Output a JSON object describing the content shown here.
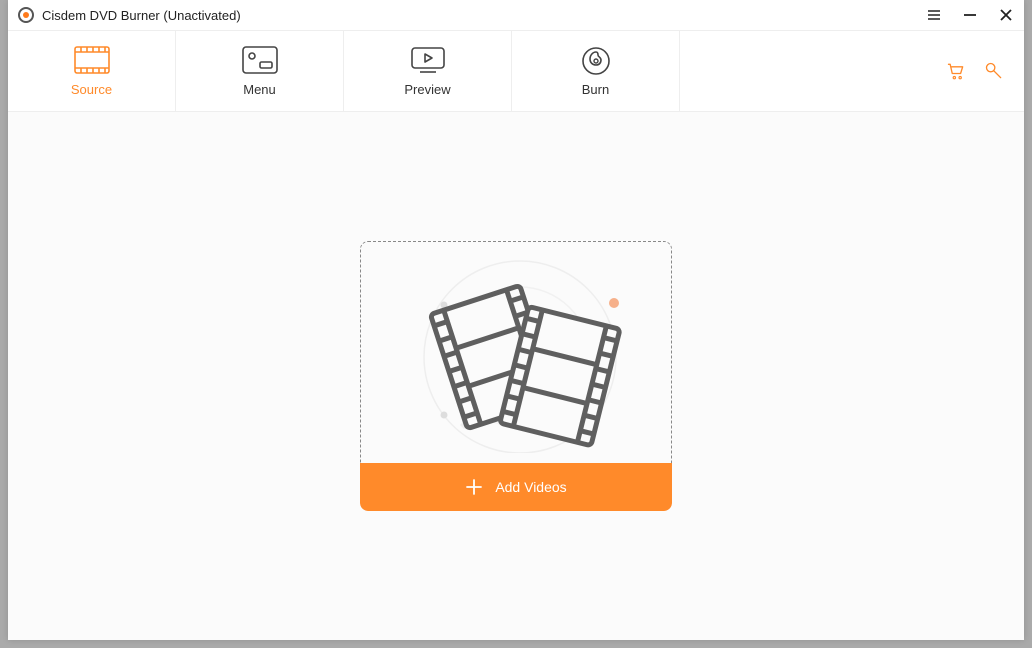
{
  "window": {
    "title": "Cisdem DVD Burner (Unactivated)"
  },
  "tabs": {
    "source": "Source",
    "menu": "Menu",
    "preview": "Preview",
    "burn": "Burn"
  },
  "actions": {
    "add_videos": "Add Videos"
  }
}
